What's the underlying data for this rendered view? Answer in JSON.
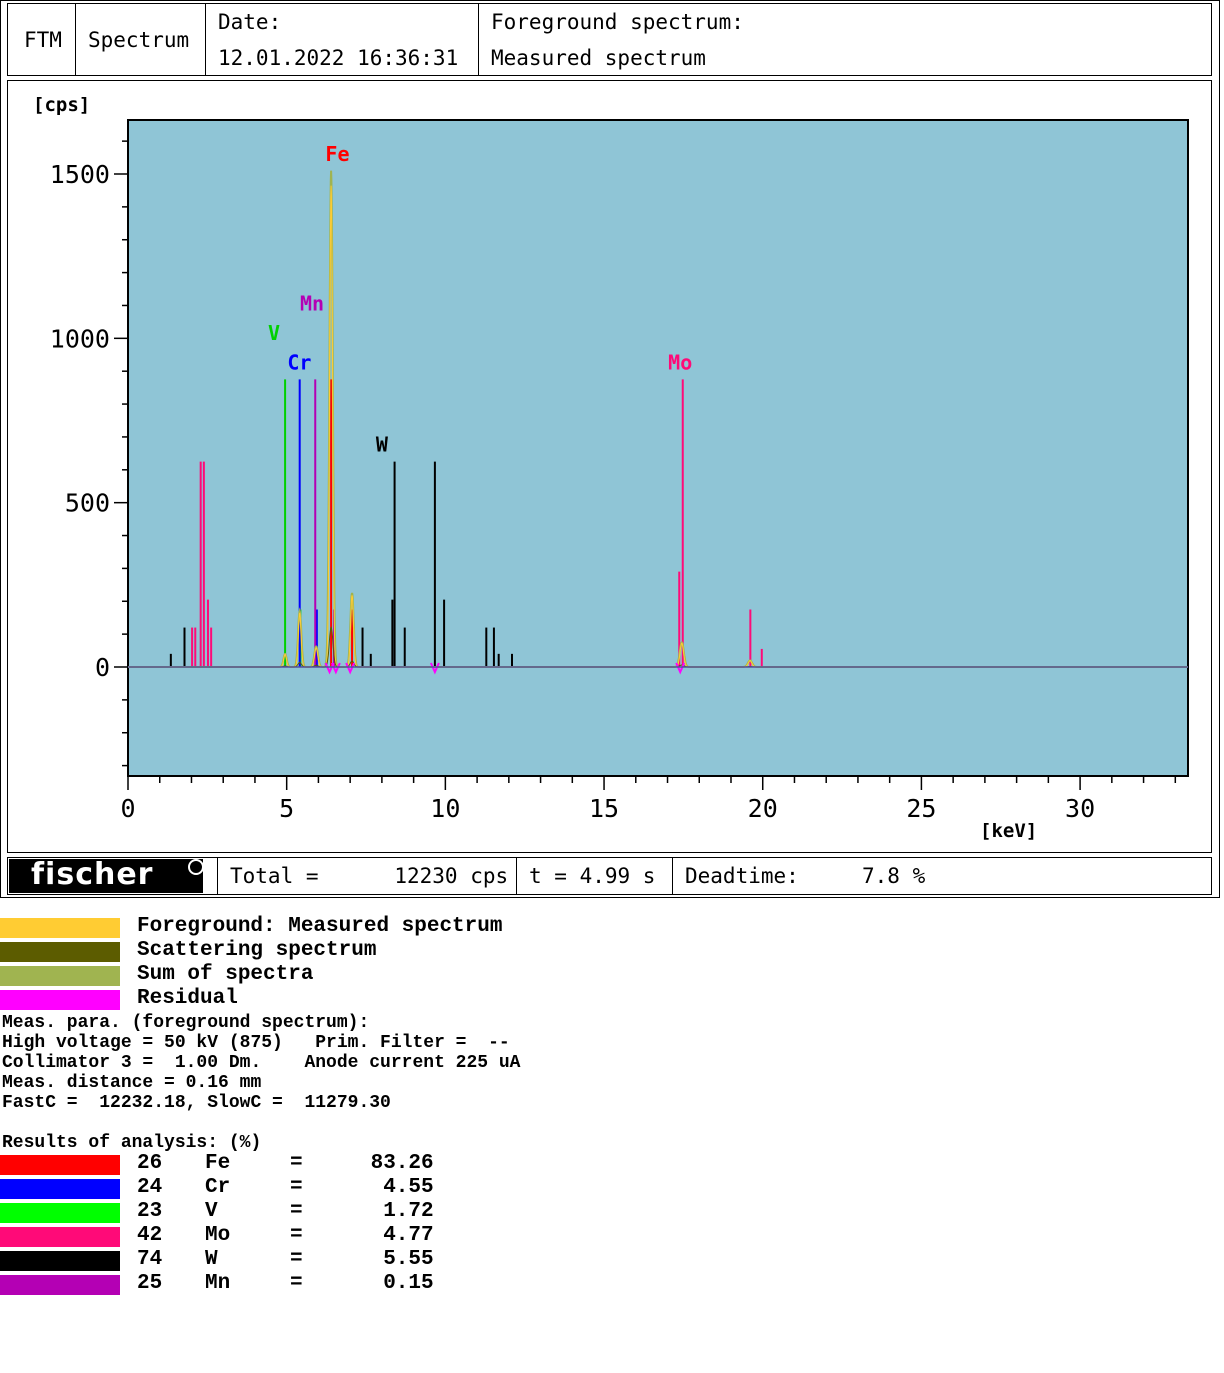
{
  "header": {
    "ftm": "FTM",
    "mode": "Spectrum",
    "date_label": "Date:",
    "date_value": "12.01.2022 16:36:31",
    "fg_label": "Foreground spectrum:",
    "fg_value": "Measured spectrum"
  },
  "footer": {
    "logo": "fischer",
    "total": "Total =      12230 cps",
    "time": "t = 4.99 s",
    "deadtime": "Deadtime:     7.8 %"
  },
  "legend": [
    {
      "label": "Foreground: Measured spectrum",
      "color": "#ffcc33"
    },
    {
      "label": "Scattering spectrum",
      "color": "#5c5c00"
    },
    {
      "label": "Sum of spectra",
      "color": "#a0b450"
    },
    {
      "label": "Residual",
      "color": "#ff00ff"
    }
  ],
  "params": [
    "Meas. para. (foreground spectrum):",
    "High voltage = 50 kV (875)   Prim. Filter =  --",
    "Collimator 3 =  1.00 Dm.    Anode current 225 uA",
    "Meas. distance = 0.16 mm",
    "FastC =  12232.18, SlowC =  11279.30"
  ],
  "results_title": "Results of analysis: (%)",
  "results": [
    {
      "z": "26",
      "el": "Fe",
      "eq": "=",
      "val": "83.26",
      "color": "#ff0000"
    },
    {
      "z": "24",
      "el": "Cr",
      "eq": "=",
      "val": "4.55",
      "color": "#0000ff"
    },
    {
      "z": "23",
      "el": "V",
      "eq": "=",
      "val": "1.72",
      "color": "#00ff00"
    },
    {
      "z": "42",
      "el": "Mo",
      "eq": "=",
      "val": "4.77",
      "color": "#ff0a78"
    },
    {
      "z": "74",
      "el": "W",
      "eq": "=",
      "val": "5.55",
      "color": "#000000"
    },
    {
      "z": "25",
      "el": "Mn",
      "eq": "=",
      "val": "0.15",
      "color": "#b400b4"
    }
  ],
  "chart_data": {
    "type": "line",
    "ylabel": "[cps]",
    "xlabel": "[keV]",
    "xlim": [
      0,
      33.4
    ],
    "ylim": [
      -335,
      1660
    ],
    "xticks": [
      0,
      5,
      10,
      15,
      20,
      25,
      30
    ],
    "yticks": [
      0,
      500,
      1000,
      1500
    ],
    "background": "#8fc5d6",
    "series_colors": {
      "sum": "#a0b450",
      "measured": "#ffcc33",
      "scatter": "#5c5c00",
      "residual": "#ff00ff"
    },
    "peaks": [
      {
        "x": 5.41,
        "y": 170
      },
      {
        "x": 5.95,
        "y": 40
      },
      {
        "x": 5.9,
        "y": 30
      },
      {
        "x": 6.4,
        "y": 1510
      },
      {
        "x": 7.06,
        "y": 225
      },
      {
        "x": 4.95,
        "y": 40
      },
      {
        "x": 17.45,
        "y": 75
      },
      {
        "x": 19.6,
        "y": 20
      }
    ],
    "element_lines": [
      {
        "element": "V",
        "color": "#00d000",
        "lines": [
          {
            "x": 4.95,
            "y": 875
          },
          {
            "x": 5.43,
            "y": 175
          }
        ]
      },
      {
        "element": "Cr",
        "color": "#0000ff",
        "lines": [
          {
            "x": 5.41,
            "y": 875
          },
          {
            "x": 5.95,
            "y": 175
          }
        ]
      },
      {
        "element": "Mn",
        "color": "#b400b4",
        "lines": [
          {
            "x": 5.9,
            "y": 875
          },
          {
            "x": 6.49,
            "y": 175
          }
        ]
      },
      {
        "element": "Fe",
        "color": "#ff0000",
        "lines": [
          {
            "x": 6.4,
            "y": 875
          },
          {
            "x": 7.06,
            "y": 175
          }
        ]
      },
      {
        "element": "W",
        "color": "#000000",
        "lines": [
          {
            "x": 1.35,
            "y": 40
          },
          {
            "x": 1.78,
            "y": 120
          },
          {
            "x": 8.4,
            "y": 625
          },
          {
            "x": 9.67,
            "y": 625
          },
          {
            "x": 8.33,
            "y": 205
          },
          {
            "x": 8.72,
            "y": 120
          },
          {
            "x": 9.96,
            "y": 205
          },
          {
            "x": 11.29,
            "y": 120
          },
          {
            "x": 11.53,
            "y": 120
          },
          {
            "x": 11.68,
            "y": 40
          },
          {
            "x": 12.1,
            "y": 40
          },
          {
            "x": 7.39,
            "y": 120
          },
          {
            "x": 7.65,
            "y": 40
          }
        ]
      },
      {
        "element": "Mo",
        "color": "#ff0a78",
        "lines": [
          {
            "x": 17.48,
            "y": 875
          },
          {
            "x": 17.37,
            "y": 290
          },
          {
            "x": 19.61,
            "y": 175
          },
          {
            "x": 19.97,
            "y": 55
          },
          {
            "x": 2.29,
            "y": 625
          },
          {
            "x": 2.39,
            "y": 625
          },
          {
            "x": 2.52,
            "y": 205
          },
          {
            "x": 2.62,
            "y": 120
          },
          {
            "x": 2.02,
            "y": 120
          },
          {
            "x": 2.12,
            "y": 120
          }
        ]
      }
    ],
    "element_labels": [
      {
        "text": "Fe",
        "x": 6.6,
        "y": 1540,
        "color": "#ff0000"
      },
      {
        "text": "Mn",
        "x": 5.8,
        "y": 1085,
        "color": "#b400b4"
      },
      {
        "text": "V",
        "x": 4.6,
        "y": 995,
        "color": "#00d000"
      },
      {
        "text": "Cr",
        "x": 5.4,
        "y": 905,
        "color": "#0000ff"
      },
      {
        "text": "W",
        "x": 8.0,
        "y": 655,
        "color": "#000000"
      },
      {
        "text": "Mo",
        "x": 17.4,
        "y": 905,
        "color": "#ff0a78"
      }
    ]
  }
}
